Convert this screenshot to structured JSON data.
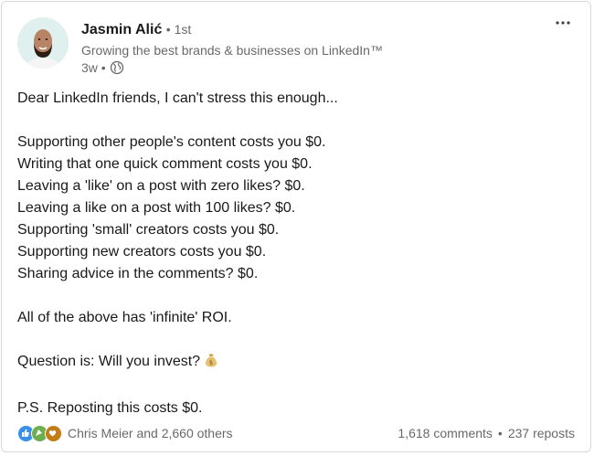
{
  "post": {
    "author": {
      "name": "Jasmin Alić",
      "degree": "• 1st",
      "headline": "Growing the best brands & businesses on LinkedIn™",
      "time": "3w •"
    },
    "body_lines": [
      "Dear LinkedIn friends, I can't stress this enough...",
      "",
      "Supporting other people's content costs you $0.",
      "Writing that one quick comment costs you $0.",
      "Leaving a 'like' on a post with zero likes? $0.",
      "Leaving a like on a post with 100 likes? $0.",
      "Supporting 'small' creators costs you $0.",
      "Supporting new creators costs you $0.",
      "Sharing advice in the comments? $0.",
      "",
      "All of the above has 'infinite' ROI.",
      "",
      "Question is: Will you invest?",
      "",
      "P.S. Reposting this costs $0."
    ],
    "emoji_after_line": 12,
    "emoji_icon": "money-bag-icon",
    "social": {
      "reactions_text": "Chris Meier and 2,660 others",
      "comments": "1,618 comments",
      "separator": "•",
      "reposts": "237 reposts"
    },
    "icons": [
      "globe-icon",
      "more-options-icon",
      "like-reaction-icon",
      "celebrate-reaction-icon",
      "support-reaction-icon"
    ],
    "colors": {
      "like": "#378fe9",
      "celebrate": "#6dae4f",
      "support": "#c37d16"
    }
  }
}
